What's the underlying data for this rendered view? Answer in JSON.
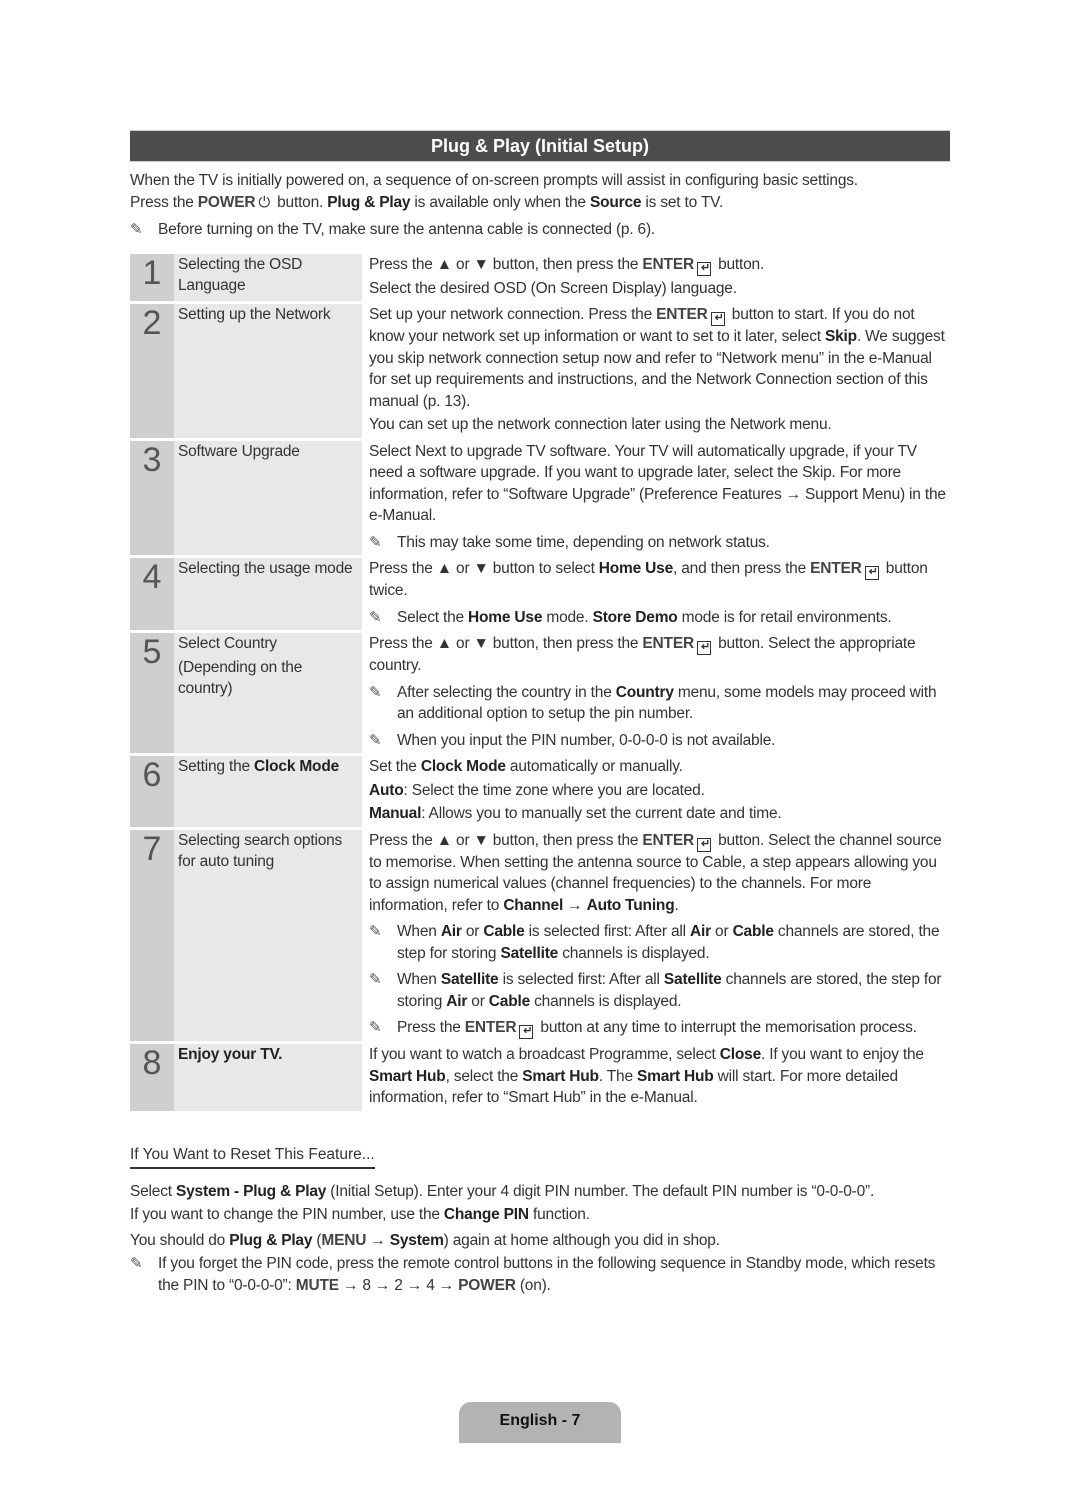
{
  "title": "Plug & Play (Initial Setup)",
  "intro": {
    "line1": "When the TV is initially powered on, a sequence of on-screen prompts will assist in configuring basic settings.",
    "line2_a": "Press the ",
    "power_key": "POWER",
    "line2_b": " button. ",
    "line2_bold1": "Plug & Play",
    "line2_c": " is available only when the ",
    "line2_bold2": "Source",
    "line2_d": " is set to TV.",
    "note": "Before turning on the TV, make sure the antenna cable is connected (p. 6)."
  },
  "icons": {
    "note": "✎",
    "power": "⏻",
    "enter": "↵",
    "up": "▲",
    "down": "▼",
    "arrow": "→"
  },
  "steps": [
    {
      "num": "1",
      "label": "Selecting the OSD Language",
      "p1_a": "Press the ▲ or ▼ button, then press the ",
      "enter": "ENTER",
      "p1_b": " button.",
      "p2": "Select the desired OSD (On Screen Display) language."
    },
    {
      "num": "2",
      "label": "Setting up the Network",
      "p1_a": "Set up your network connection. Press the ",
      "enter": "ENTER",
      "p1_b": " button to start. If you do not know your network set up information or want to set to it later, select ",
      "p1_bold": "Skip",
      "p1_c": ". We suggest you skip network connection setup now and refer to “Network menu” in the e-Manual for set up requirements and instructions, and the Network Connection section of this manual (p. 13).",
      "p2": "You can set up the network connection later using the Network menu."
    },
    {
      "num": "3",
      "label": "Software Upgrade",
      "p1": "Select Next to upgrade TV software. Your TV will automatically upgrade, if your TV need a software upgrade. If you want to upgrade later, select the Skip. For more information, refer to “Software Upgrade” (Preference Features → Support Menu) in the e-Manual.",
      "note": "This may take some time, depending on network status."
    },
    {
      "num": "4",
      "label": "Selecting the usage mode",
      "p1_a": "Press the ▲ or ▼ button to select ",
      "p1_bold": "Home Use",
      "p1_b": ", and then press the ",
      "enter": "ENTER",
      "p1_c": " button twice.",
      "note_a": "Select the ",
      "note_bold1": "Home Use",
      "note_b": " mode. ",
      "note_bold2": "Store Demo",
      "note_c": " mode is for retail environments."
    },
    {
      "num": "5",
      "label": "Select Country",
      "label2": "(Depending on the country)",
      "p1_a": "Press the ▲ or ▼ button, then press the ",
      "enter": "ENTER",
      "p1_b": " button. Select the appropriate country.",
      "note1_a": "After selecting the country in the ",
      "note1_bold": "Country",
      "note1_b": " menu, some models may proceed with an additional option to setup the pin number.",
      "note2": "When you input the PIN number, 0-0-0-0 is not available."
    },
    {
      "num": "6",
      "label_a": "Setting the ",
      "label_bold": "Clock Mode",
      "p1_a": "Set the ",
      "p1_bold": "Clock Mode",
      "p1_b": " automatically or manually.",
      "p2_bold": "Auto",
      "p2": ": Select the time zone where you are located.",
      "p3_bold": "Manual",
      "p3": ": Allows you to manually set the current date and time."
    },
    {
      "num": "7",
      "label": "Selecting search options for auto tuning",
      "p1_a": "Press the ▲ or ▼ button, then press the ",
      "enter": "ENTER",
      "p1_b": " button. Select the channel source to memorise. When setting the antenna source to Cable, a step appears allowing you to assign numerical values (channel frequencies) to the channels. For more information, refer to ",
      "p1_bold1": "Channel",
      "p1_c": " → ",
      "p1_bold2": "Auto Tuning",
      "p1_d": ".",
      "note1_a": "When ",
      "note1_b1": "Air",
      "note1_b": " or ",
      "note1_b2": "Cable",
      "note1_c": " is selected first: After all ",
      "note1_b3": "Air",
      "note1_d": " or ",
      "note1_b4": "Cable",
      "note1_e": " channels are stored, the step for storing ",
      "note1_b5": "Satellite",
      "note1_f": " channels is displayed.",
      "note2_a": "When ",
      "note2_b1": "Satellite",
      "note2_b": " is selected first: After all ",
      "note2_b2": "Satellite",
      "note2_c": " channels are stored, the step for storing ",
      "note2_b3": "Air",
      "note2_d": " or ",
      "note2_b4": "Cable",
      "note2_e": " channels is displayed.",
      "note3_a": "Press the ",
      "note3_enter": "ENTER",
      "note3_b": " button at any time to interrupt the memorisation process."
    },
    {
      "num": "8",
      "label": "Enjoy your TV.",
      "p1_a": "If you want to watch a broadcast Programme, select ",
      "p1_b1": "Close",
      "p1_b": ". If you want to enjoy the ",
      "p1_b2": "Smart Hub",
      "p1_c": ", select the ",
      "p1_b3": "Smart Hub",
      "p1_d": ". The ",
      "p1_b4": "Smart Hub",
      "p1_e": " will start. For more detailed information, refer to “Smart Hub” in the e-Manual."
    }
  ],
  "reset": {
    "heading": "If You Want to Reset This Feature...",
    "p1_a": "Select ",
    "p1_b1": "System - Plug & Play",
    "p1_b": " (Initial Setup). Enter your 4 digit PIN number. The default PIN number is “0-0-0-0”.",
    "p2_a": "If you want to change the PIN number, use the ",
    "p2_bold": "Change PIN",
    "p2_b": " function.",
    "p3_a": "You should do ",
    "p3_bold1": "Plug & Play",
    "p3_b": " (",
    "p3_key": "MENU",
    "p3_c": " → ",
    "p3_bold2": "System",
    "p3_d": ") again at home although you did in shop.",
    "note_a": "If you forget the PIN code, press the remote control buttons in the following sequence in Standby mode, which resets the PIN to “0-0-0-0”: ",
    "note_key1": "MUTE",
    "note_b": " → 8 → 2 → 4 → ",
    "note_key2": "POWER",
    "note_c": " (on)."
  },
  "footer": {
    "page_label": "English - 7"
  }
}
